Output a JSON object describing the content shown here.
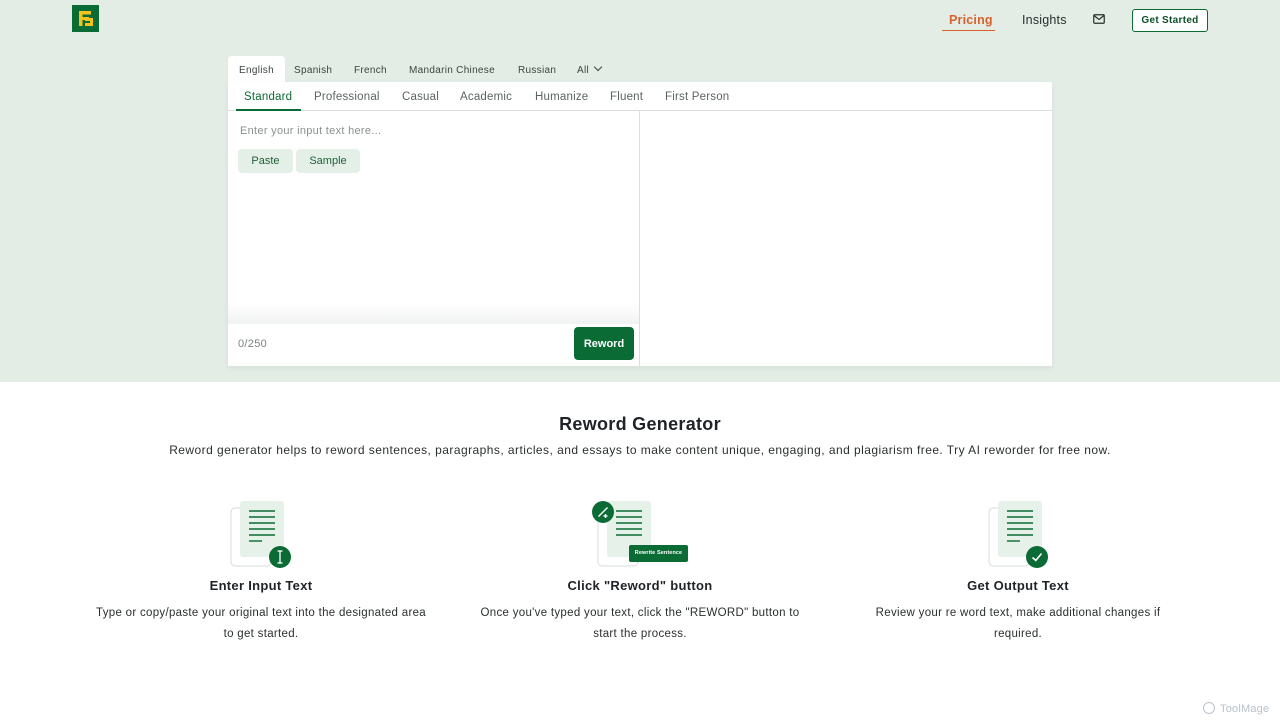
{
  "header": {
    "nav": {
      "pricing": "Pricing",
      "insights": "Insights"
    },
    "cta": "Get Started"
  },
  "languages": [
    "English",
    "Spanish",
    "French",
    "Mandarin Chinese",
    "Russian",
    "All"
  ],
  "active_language": "English",
  "modes": [
    "Standard",
    "Professional",
    "Casual",
    "Academic",
    "Humanize",
    "Fluent",
    "First Person"
  ],
  "active_mode": "Standard",
  "editor": {
    "placeholder": "Enter your input text here...",
    "paste": "Paste",
    "sample": "Sample",
    "count": "0/250",
    "submit": "Reword"
  },
  "intro": {
    "title": "Reword Generator",
    "description": "Reword generator helps to reword sentences, paragraphs, articles, and essays to make content unique, engaging, and plagiarism free. Try AI reworder for free now."
  },
  "steps": [
    {
      "title": "Enter Input Text",
      "desc": "Type or copy/paste your original text into the designated area to get started.",
      "icon": "document-cursor-icon"
    },
    {
      "title": "Click \"Reword\" button",
      "desc": "Once you've typed your text, click the \"REWORD\" button to start the process.",
      "icon": "document-rewrite-icon",
      "badge": "Rewrite Sentence"
    },
    {
      "title": "Get Output Text",
      "desc": "Review your re word text, make additional changes if required.",
      "icon": "document-check-icon"
    }
  ],
  "watermark": "ToolMage",
  "colors": {
    "brand_green": "#0b6b34",
    "accent_orange": "#d9622b",
    "hero_bg": "#e3ede6"
  }
}
